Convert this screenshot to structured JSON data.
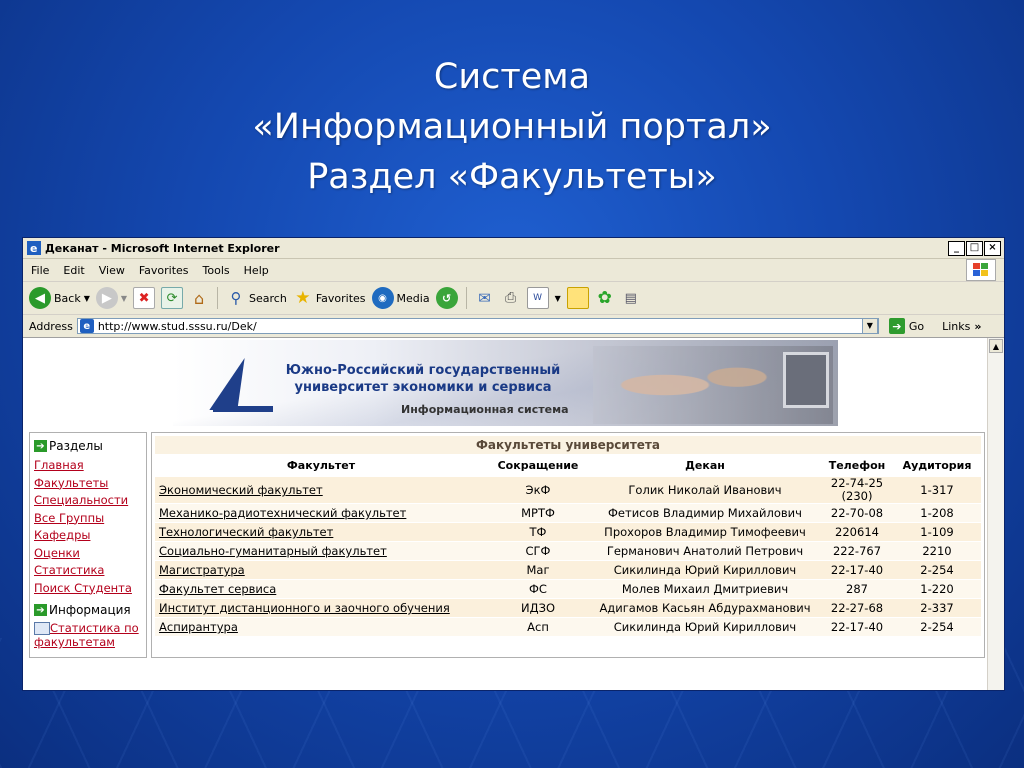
{
  "slide": {
    "title_lines": [
      "Система",
      "«Информационный портал»",
      "Раздел «Факультеты»"
    ]
  },
  "window": {
    "title": "Деканат - Microsoft Internet Explorer",
    "controls": [
      "_",
      "□",
      "×"
    ]
  },
  "menu": [
    "File",
    "Edit",
    "View",
    "Favorites",
    "Tools",
    "Help"
  ],
  "toolbar": {
    "back": "Back",
    "search": "Search",
    "favorites": "Favorites",
    "media": "Media"
  },
  "address": {
    "label": "Address",
    "url": "http://www.stud.sssu.ru/Dek/",
    "go": "Go",
    "links": "Links"
  },
  "banner": {
    "university_line1": "Южно-Российский государственный",
    "university_line2": "университет экономики и сервиса",
    "system": "Информационная система"
  },
  "sidebar": {
    "sections_heading": "Разделы",
    "links": [
      "Главная",
      "Факультеты",
      "Специальности",
      "Все Группы",
      "Кафедры",
      "Оценки",
      "Статистика",
      "Поиск Студента"
    ],
    "info_heading": "Информация",
    "stats_link_line1": "Статистика по",
    "stats_link_line2": "факультетам"
  },
  "content": {
    "title": "Факультеты университета",
    "columns": [
      "Факультет",
      "Сокращение",
      "Декан",
      "Телефон",
      "Аудитория"
    ],
    "rows": [
      {
        "name": "Экономический факультет",
        "abbr": "ЭкФ",
        "dean": "Голик Николай Иванович",
        "phone": "22-74-25 (230)",
        "room": "1-317"
      },
      {
        "name": "Механико-радиотехнический факультет",
        "abbr": "МРТФ",
        "dean": "Фетисов Владимир Михайлович",
        "phone": "22-70-08",
        "room": "1-208"
      },
      {
        "name": "Технологический факультет",
        "abbr": "ТФ",
        "dean": "Прохоров Владимир Тимофеевич",
        "phone": "220614",
        "room": "1-109"
      },
      {
        "name": "Социально-гуманитарный факультет",
        "abbr": "СГФ",
        "dean": "Германович Анатолий Петрович",
        "phone": "222-767",
        "room": "2210"
      },
      {
        "name": "Магистратура",
        "abbr": "Маг",
        "dean": "Сикилинда Юрий Кириллович",
        "phone": "22-17-40",
        "room": "2-254"
      },
      {
        "name": "Факультет сервиса",
        "abbr": "ФС",
        "dean": "Молев Михаил Дмитриевич",
        "phone": "287",
        "room": "1-220"
      },
      {
        "name": "Институт дистанционного и заочного обучения",
        "abbr": "ИДЗО",
        "dean": "Адигамов Касьян Абдурахманович",
        "phone": "22-27-68",
        "room": "2-337"
      },
      {
        "name": "Аспирантура",
        "abbr": "Асп",
        "dean": "Сикилинда Юрий Кириллович",
        "phone": "22-17-40",
        "room": "2-254"
      }
    ]
  }
}
